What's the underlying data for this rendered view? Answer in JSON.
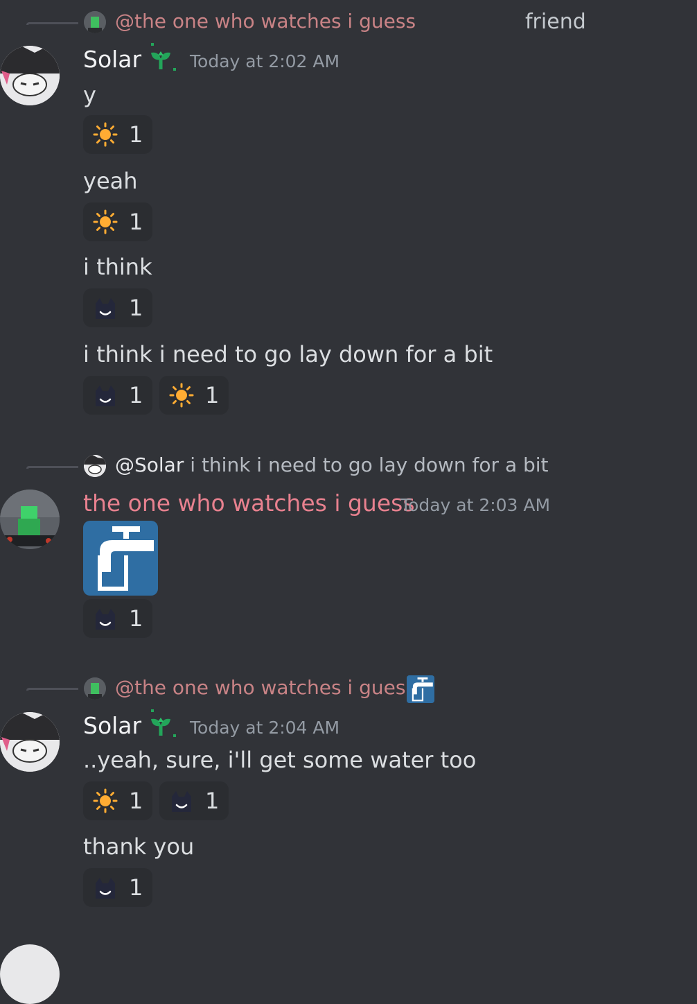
{
  "tag_text": "friend",
  "groups": [
    {
      "reply_to_name": "@the one who watches i guess",
      "reply_snippet": "",
      "author": "Solar",
      "timestamp": "Today at 2:02 AM",
      "messages": [
        {
          "text": "y",
          "reactions": [
            {
              "emoji": "sun-icon",
              "count": "1"
            }
          ]
        },
        {
          "text": "yeah",
          "reactions": [
            {
              "emoji": "sun-icon",
              "count": "1"
            }
          ]
        },
        {
          "text": "i think",
          "reactions": [
            {
              "emoji": "cat-icon",
              "count": "1"
            }
          ]
        },
        {
          "text": "i think i need to go lay down for a bit",
          "reactions": [
            {
              "emoji": "cat-icon",
              "count": "1"
            },
            {
              "emoji": "sun-icon",
              "count": "1"
            }
          ]
        }
      ]
    },
    {
      "reply_to_name": "@Solar",
      "reply_snippet": "i think i need to go lay down for a bit",
      "author": "the one who watches i guess",
      "timestamp": "Today at 2:03 AM",
      "messages": [
        {
          "text": "",
          "image": "water-tap-icon",
          "reactions": [
            {
              "emoji": "cat-icon",
              "count": "1"
            }
          ]
        }
      ]
    },
    {
      "reply_to_name": "@the one who watches i guess",
      "reply_snippet": "",
      "author": "Solar",
      "timestamp": "Today at 2:04 AM",
      "messages": [
        {
          "text": "..yeah, sure, i'll get some water too",
          "reactions": [
            {
              "emoji": "sun-icon",
              "count": "1"
            },
            {
              "emoji": "cat-icon",
              "count": "1"
            }
          ]
        },
        {
          "text": "thank you",
          "reactions": [
            {
              "emoji": "cat-icon",
              "count": "1"
            }
          ]
        }
      ]
    }
  ],
  "colors": {
    "background": "#313338",
    "reaction_bg": "#2b2d31",
    "reply_name": "#c98386",
    "other_username": "#e8818f",
    "badge_green": "#23a55a",
    "tap_blue": "#2f6ea3"
  }
}
